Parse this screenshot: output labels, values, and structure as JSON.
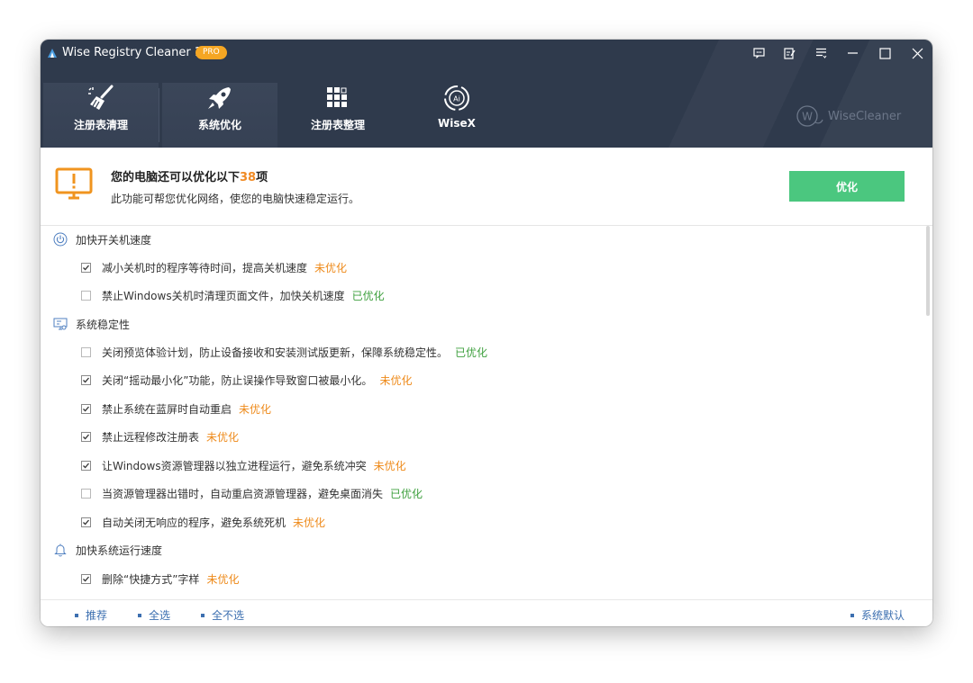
{
  "app": {
    "title": "Wise Registry Cleaner 11",
    "badge": "PRO"
  },
  "nav": {
    "tabs": [
      {
        "label": "注册表清理",
        "icon": "broom-icon"
      },
      {
        "label": "系统优化",
        "icon": "rocket-icon"
      },
      {
        "label": "注册表整理",
        "icon": "grid-blocks-icon"
      },
      {
        "label": "WiseX",
        "icon": "ai-swirl-icon"
      }
    ],
    "active": "系统优化",
    "brand": "WiseCleaner"
  },
  "banner": {
    "title_prefix": "您的电脑还可以优化以下",
    "count": "38",
    "title_suffix": "项",
    "subtitle": "此功能可帮您优化网络，使您的电脑快速稳定运行。",
    "button": "优化"
  },
  "categories": [
    {
      "name": "加快开关机速度",
      "icon": "power-icon"
    },
    {
      "name": "系统稳定性",
      "icon": "monitor-settings-icon"
    },
    {
      "name": "加快系统运行速度",
      "icon": "bell-icon"
    }
  ],
  "items": [
    {
      "text": "减小关机时的程序等待时间，提高关机速度",
      "status": "未优化",
      "checked": true
    },
    {
      "text": "禁止Windows关机时清理页面文件，加快关机速度",
      "status": "已优化",
      "checked": false
    },
    {
      "text": "关闭预览体验计划，防止设备接收和安装测试版更新，保障系统稳定性。",
      "status": "已优化",
      "checked": false
    },
    {
      "text": "关闭“摇动最小化”功能，防止误操作导致窗口被最小化。",
      "status": "未优化",
      "checked": true
    },
    {
      "text": "禁止系统在蓝屏时自动重启",
      "status": "未优化",
      "checked": true
    },
    {
      "text": "禁止远程修改注册表",
      "status": "未优化",
      "checked": true
    },
    {
      "text": "让Windows资源管理器以独立进程运行，避免系统冲突",
      "status": "未优化",
      "checked": true
    },
    {
      "text": "当资源管理器出错时，自动重启资源管理器，避免桌面消失",
      "status": "已优化",
      "checked": false
    },
    {
      "text": "自动关闭无响应的程序，避免系统死机",
      "status": "未优化",
      "checked": true
    },
    {
      "text": "删除“快捷方式”字样",
      "status": "未优化",
      "checked": true
    }
  ],
  "footer": {
    "recommend": "推荐",
    "select_all": "全选",
    "select_none": "全不选",
    "default": "系统默认"
  },
  "colors": {
    "header_bg": "#2f3a4c",
    "accent_orange": "#f08a24",
    "status_unoptimized": "#ee8a1a",
    "status_optimized": "#3ea03e",
    "button_green": "#4bc77f",
    "link_blue": "#3c6fb0"
  }
}
